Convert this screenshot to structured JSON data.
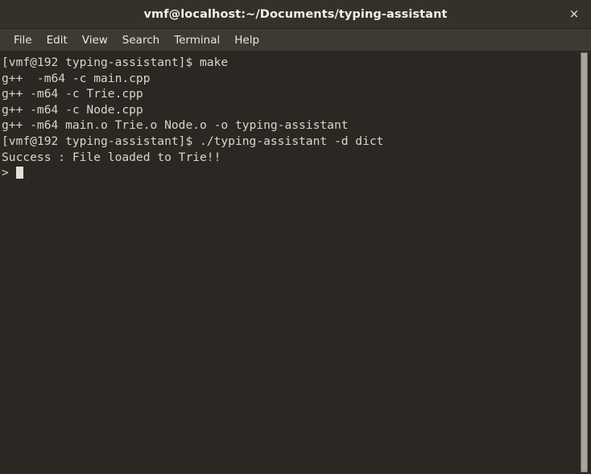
{
  "window": {
    "title": "vmf@localhost:~/Documents/typing-assistant",
    "close_icon": "×",
    "colors": {
      "titlebar_bg": "#34312b",
      "menubar_bg": "#3d3a34",
      "terminal_bg": "#2b2823",
      "terminal_fg": "#d9d5cd",
      "scrollbar_thumb": "#a9a69f"
    }
  },
  "menubar": {
    "items": [
      {
        "label": "File"
      },
      {
        "label": "Edit"
      },
      {
        "label": "View"
      },
      {
        "label": "Search"
      },
      {
        "label": "Terminal"
      },
      {
        "label": "Help"
      }
    ]
  },
  "terminal": {
    "lines": [
      "[vmf@192 typing-assistant]$ make",
      "g++  -m64 -c main.cpp",
      "g++ -m64 -c Trie.cpp",
      "g++ -m64 -c Node.cpp",
      "g++ -m64 main.o Trie.o Node.o -o typing-assistant",
      "[vmf@192 typing-assistant]$ ./typing-assistant -d dict",
      "Success : File loaded to Trie!!"
    ],
    "prompt": "> ",
    "cursor_visible": true
  }
}
